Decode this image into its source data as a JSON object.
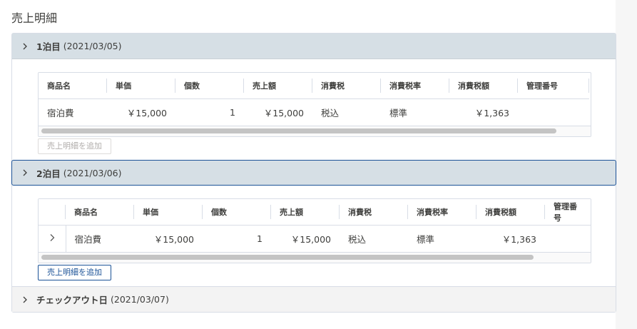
{
  "page": {
    "title": "売上明細"
  },
  "sections": [
    {
      "label": "1泊目",
      "date": "(2021/03/05)",
      "add_button": "売上明細を追加",
      "columns": [
        "商品名",
        "単価",
        "個数",
        "売上額",
        "消費税",
        "消費税率",
        "消費税額",
        "管理番号"
      ],
      "rows": [
        {
          "product": "宿泊費",
          "unit_price": "￥15,000",
          "qty": "1",
          "sales": "￥15,000",
          "tax": "税込",
          "tax_rate": "標準",
          "tax_amount": "￥1,363",
          "control_no": ""
        }
      ]
    },
    {
      "label": "2泊目",
      "date": "(2021/03/06)",
      "add_button": "売上明細を追加",
      "columns": [
        "商品名",
        "単価",
        "個数",
        "売上額",
        "消費税",
        "消費税率",
        "消費税額",
        "管理番号"
      ],
      "rows": [
        {
          "product": "宿泊費",
          "unit_price": "￥15,000",
          "qty": "1",
          "sales": "￥15,000",
          "tax": "税込",
          "tax_rate": "標準",
          "tax_amount": "￥1,363",
          "control_no": ""
        }
      ]
    },
    {
      "label": "チェックアウト日",
      "date": "(2021/03/07)"
    }
  ],
  "colors": {
    "header_bg": "#d6dfe5",
    "focus_border": "#1b5297",
    "border": "#d8dde6"
  },
  "icons": {
    "section_toggle": "chevron-right-icon",
    "row_expand": "chevron-right-icon"
  }
}
